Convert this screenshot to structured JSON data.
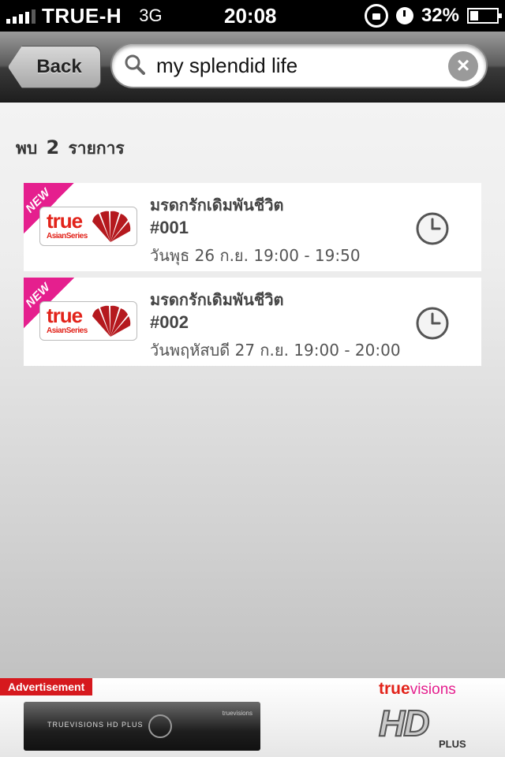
{
  "status_bar": {
    "carrier": "TRUE-H",
    "network": "3G",
    "time": "20:08",
    "battery": "32%",
    "battery_level": 0.32
  },
  "nav": {
    "back_label": "Back",
    "search_value": "my splendid life"
  },
  "results": {
    "prefix": "พบ",
    "count": "2",
    "suffix": "รายการ",
    "items": [
      {
        "badge": "NEW",
        "channel": "true",
        "channel_sub": "AsianSeries",
        "title": "มรดกรักเดิมพันชีวิต",
        "episode": "#001",
        "time": "วันพุธ 26 ก.ย. 19:00 - 19:50"
      },
      {
        "badge": "NEW",
        "channel": "true",
        "channel_sub": "AsianSeries",
        "title": "มรดกรักเดิมพันชีวิต",
        "episode": "#002",
        "time": "วันพฤหัสบดี 27 ก.ย. 19:00 - 20:00"
      }
    ]
  },
  "ad": {
    "label": "Advertisement",
    "stb_model": "TRUEVISIONS HD PLUS",
    "stb_brand": "truevisions",
    "brand_true": "true",
    "brand_visions": "visions",
    "hd": "HD",
    "plus": "PLUS"
  },
  "colors": {
    "brand_red": "#e2231a",
    "new_pink": "#e51f8e",
    "ad_red": "#d6191e"
  },
  "icons": [
    "signal-icon",
    "rotation-lock-icon",
    "alarm-icon",
    "battery-icon",
    "search-icon",
    "clear-icon",
    "channel-fan-icon",
    "clock-icon"
  ]
}
